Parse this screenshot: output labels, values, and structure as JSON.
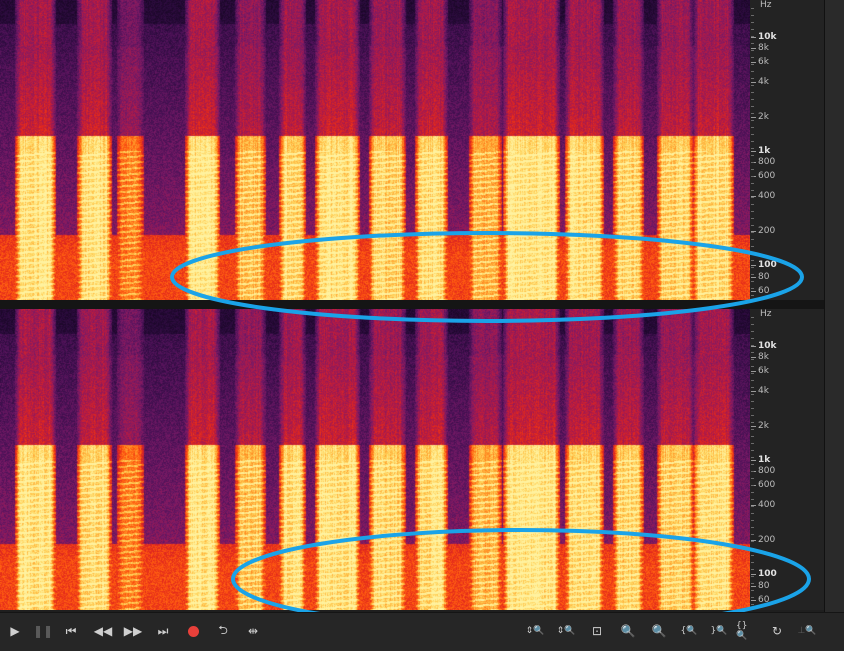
{
  "spectrogram": {
    "channels": [
      {
        "name": "top-channel"
      },
      {
        "name": "bottom-channel"
      }
    ],
    "ruler": {
      "unit": "Hz",
      "labels": [
        "10k",
        "8k",
        "6k",
        "4k",
        "2k",
        "1k",
        "800",
        "600",
        "400",
        "200",
        "100",
        "80",
        "60"
      ]
    },
    "colors": {
      "background": "#180621",
      "highlight_ellipse": "#1aa3e8",
      "palette": [
        "#0c0314",
        "#2a0b3c",
        "#4d1258",
        "#7a1a66",
        "#b01a48",
        "#e2281c",
        "#ff5a10",
        "#ff9a2a",
        "#ffd25a",
        "#fff2a0"
      ]
    }
  },
  "toolbar": {
    "transport": [
      {
        "name": "play-button",
        "icon": "play-icon",
        "glyph": "▶",
        "enabled": true
      },
      {
        "name": "pause-button",
        "icon": "pause-icon",
        "glyph": "❚❚",
        "enabled": false
      },
      {
        "name": "go-to-start-button",
        "icon": "skip-back-icon",
        "glyph": "⏮",
        "enabled": true
      },
      {
        "name": "rewind-button",
        "icon": "rewind-icon",
        "glyph": "◀◀",
        "enabled": true
      },
      {
        "name": "fast-forward-button",
        "icon": "fast-forward-icon",
        "glyph": "▶▶",
        "enabled": true
      },
      {
        "name": "go-to-end-button",
        "icon": "skip-forward-icon",
        "glyph": "⏭",
        "enabled": true
      },
      {
        "name": "record-button",
        "icon": "record-icon",
        "glyph": "",
        "enabled": true
      },
      {
        "name": "loop-button",
        "icon": "loop-icon",
        "glyph": "⮌",
        "enabled": true
      },
      {
        "name": "skip-selection-button",
        "icon": "skip-selection-icon",
        "glyph": "⇹",
        "enabled": true
      }
    ],
    "zoom": [
      {
        "name": "zoom-in-amplitude-button",
        "icon": "zoom-in-amplitude-icon",
        "glyph": "⇕🔍",
        "enabled": true
      },
      {
        "name": "zoom-out-amplitude-button",
        "icon": "zoom-out-amplitude-icon",
        "glyph": "⇕🔍",
        "enabled": true
      },
      {
        "name": "zoom-full-button",
        "icon": "zoom-full-icon",
        "glyph": "⊡",
        "enabled": true
      },
      {
        "name": "zoom-selection-button",
        "icon": "zoom-selection-icon",
        "glyph": "🔍",
        "enabled": false
      },
      {
        "name": "zoom-in-time-button",
        "icon": "zoom-in-time-icon",
        "glyph": "🔍",
        "enabled": false
      },
      {
        "name": "zoom-to-start-button",
        "icon": "zoom-to-start-icon",
        "glyph": "{🔍",
        "enabled": true
      },
      {
        "name": "zoom-to-end-button",
        "icon": "zoom-to-end-icon",
        "glyph": "}🔍",
        "enabled": true
      },
      {
        "name": "zoom-out-full-button",
        "icon": "zoom-out-full-icon",
        "glyph": "{}🔍",
        "enabled": true
      },
      {
        "name": "zoom-reset-button",
        "icon": "zoom-reset-icon",
        "glyph": "↻",
        "enabled": true
      },
      {
        "name": "zoom-amplitude-button",
        "icon": "zoom-amplitude-icon",
        "glyph": "⊥🔍",
        "enabled": false
      }
    ]
  }
}
